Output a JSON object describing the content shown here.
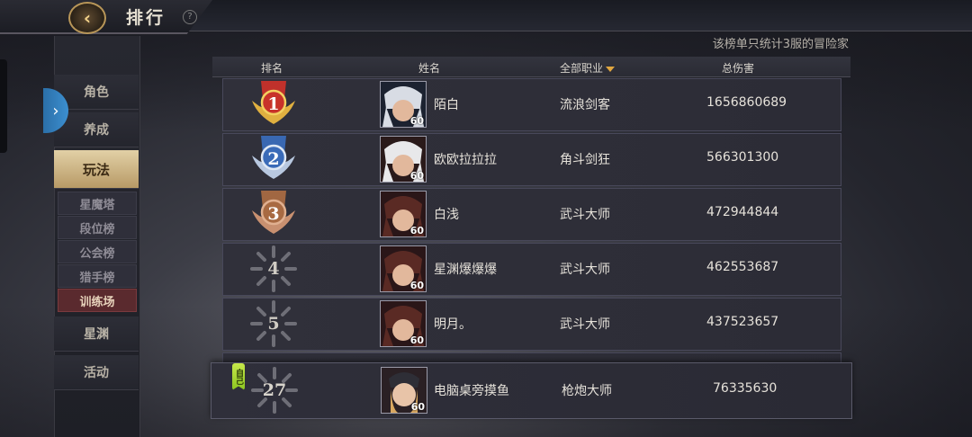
{
  "header": {
    "back_icon": "back-arrow-icon",
    "title": "排行",
    "help_icon": "question-icon"
  },
  "sidebar": {
    "items": [
      {
        "label": "角色"
      },
      {
        "label": "养成"
      },
      {
        "label": "玩法",
        "active": true
      }
    ],
    "sub_items": [
      {
        "label": "星魔塔"
      },
      {
        "label": "段位榜"
      },
      {
        "label": "公会榜"
      },
      {
        "label": "猎手榜"
      },
      {
        "label": "训练场",
        "active": true
      }
    ],
    "bottom_items": [
      {
        "label": "星渊"
      },
      {
        "label": "活动"
      }
    ]
  },
  "note": "该榜单只统计3服的冒险家",
  "table": {
    "columns": {
      "rank": "排名",
      "name": "姓名",
      "job": "全部职业",
      "damage": "总伤害"
    },
    "rows": [
      {
        "rank": "1",
        "name": "陌白",
        "level": "60",
        "job": "流浪剑客",
        "damage": "1656860689",
        "badge_color": "#c8322a"
      },
      {
        "rank": "2",
        "name": "欧欧拉拉拉",
        "level": "60",
        "job": "角斗剑狂",
        "damage": "566301300",
        "badge_color": "#3a6bb8"
      },
      {
        "rank": "3",
        "name": "白浅",
        "level": "60",
        "job": "武斗大师",
        "damage": "472944844",
        "badge_color": "#a86a42"
      },
      {
        "rank": "4",
        "name": "星渊爆爆爆",
        "level": "60",
        "job": "武斗大师",
        "damage": "462553687",
        "badge_color": "#6a6a72"
      },
      {
        "rank": "5",
        "name": "明月。",
        "level": "60",
        "job": "武斗大师",
        "damage": "437523657",
        "badge_color": "#6a6a72"
      }
    ],
    "self_row": {
      "tag": "自己",
      "rank": "27",
      "name": "电脑桌旁摸鱼",
      "level": "60",
      "job": "枪炮大师",
      "damage": "76335630"
    }
  }
}
